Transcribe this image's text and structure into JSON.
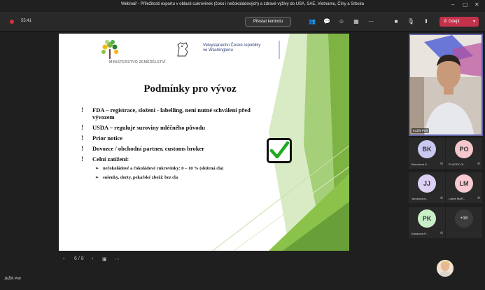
{
  "window": {
    "title": "Webinář - Příležitosti exportu v oblasti cukrovinek (čoko i nečokoládových) a zdravé výživy do USA, SAE, Vietnamu, Číny a Srbska"
  },
  "toolbar": {
    "timer": "55:41",
    "stop_presenting_label": "Přestat kontrolu",
    "leave_label": "Odejít"
  },
  "slide": {
    "ministry_label": "MINISTERSTVO ZEMĚDĚLSTVÍ",
    "embassy_line1": "Velvyslanectví České republiky",
    "embassy_line2": "ve Washingtonu",
    "title": "Podmínky pro vývoz",
    "bullets": [
      {
        "mark": "!",
        "text": "FDA – registrace, složení - labelling, není nutné schválení před vývozem"
      },
      {
        "mark": "!",
        "text": "USDA – reguluje suroviny mléčného původu"
      },
      {
        "mark": "!",
        "text": "Prior notice"
      },
      {
        "mark": "!",
        "text": "Dovozce / obchodní partner, customs broker"
      },
      {
        "mark": "!",
        "text": "Celní zatížení:"
      }
    ],
    "sub_bullets": [
      {
        "mark": "➢",
        "text": "nečokoládové a čokoládové cukrovinky: 0 – 10 % (složená cla)"
      },
      {
        "mark": "➢",
        "text": "sušenky, dorty, pekařské zboží: bez cla"
      }
    ]
  },
  "slide_nav": {
    "page": "6 / 8"
  },
  "presenter_name": "JEŽÍK Petr",
  "video": {
    "name": "KuŽík Petr"
  },
  "participants": [
    {
      "initials": "BK",
      "name": "Barnatová K.",
      "color": "#c8c8f0",
      "muted": true
    },
    {
      "initials": "PO",
      "name": "PLACEK Ot...",
      "color": "#f5c6cb",
      "muted": true
    },
    {
      "initials": "JJ",
      "name": "Jandourkov...",
      "color": "#dcd1f5",
      "muted": true
    },
    {
      "initials": "LM",
      "name": "Lukeš MAR...",
      "color": "#f8c9d1",
      "muted": true
    },
    {
      "initials": "PK",
      "name": "Kanarová P...",
      "color": "#c9efc9",
      "muted": true
    }
  ],
  "more_participants": "+18",
  "colors": {
    "accent": "#6264a7",
    "leave": "#c4314b",
    "green_dark": "#7cb342",
    "green_light": "#c5e1a5"
  }
}
